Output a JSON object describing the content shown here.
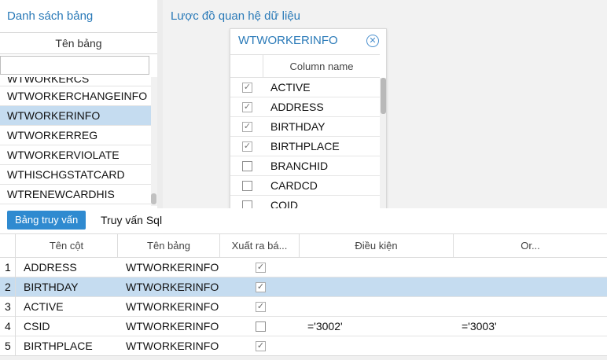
{
  "left_panel": {
    "title": "Danh sách bảng",
    "column_header": "Tên bảng",
    "filter_value": "",
    "items": [
      {
        "label": "WTWORKERCS"
      },
      {
        "label": "WTWORKERCHANGEINFO"
      },
      {
        "label": "WTWORKERINFO"
      },
      {
        "label": "WTWORKERREG"
      },
      {
        "label": "WTWORKERVIOLATE"
      },
      {
        "label": "WTHISCHGSTATCARD"
      },
      {
        "label": "WTRENEWCARDHIS"
      }
    ],
    "selected_index": 2
  },
  "diagram": {
    "title": "Lược đồ quan hệ dữ liệu",
    "entity": {
      "name": "WTWORKERINFO",
      "close_icon": "close-circle-icon",
      "column_header": "Column name",
      "columns": [
        {
          "name": "ACTIVE",
          "checked": true
        },
        {
          "name": "ADDRESS",
          "checked": true
        },
        {
          "name": "BIRTHDAY",
          "checked": true
        },
        {
          "name": "BIRTHPLACE",
          "checked": true
        },
        {
          "name": "BRANCHID",
          "checked": false
        },
        {
          "name": "CARDCD",
          "checked": false
        },
        {
          "name": "COID",
          "checked": false
        }
      ]
    }
  },
  "tabs": {
    "query_table": "Bảng truy vấn",
    "query_sql": "Truy vấn Sql"
  },
  "grid": {
    "headers": {
      "column_name": "Tên cột",
      "table_name": "Tên bảng",
      "export": "Xuất ra bá...",
      "condition": "Điều kiện",
      "or": "Or..."
    },
    "rows": [
      {
        "num": "1",
        "column": "ADDRESS",
        "table": "WTWORKERINFO",
        "export": true,
        "condition": "",
        "or": ""
      },
      {
        "num": "2",
        "column": "BIRTHDAY",
        "table": "WTWORKERINFO",
        "export": true,
        "condition": "",
        "or": ""
      },
      {
        "num": "3",
        "column": "ACTIVE",
        "table": "WTWORKERINFO",
        "export": true,
        "condition": "",
        "or": ""
      },
      {
        "num": "4",
        "column": "CSID",
        "table": "WTWORKERINFO",
        "export": false,
        "condition": "='3002'",
        "or": "='3003'"
      },
      {
        "num": "5",
        "column": "BIRTHPLACE",
        "table": "WTWORKERINFO",
        "export": true,
        "condition": "",
        "or": ""
      }
    ],
    "selected_index": 1
  },
  "colors": {
    "accent": "#2a7ab8",
    "tab_active": "#2f8ad0",
    "selection": "#c5dcf0"
  }
}
